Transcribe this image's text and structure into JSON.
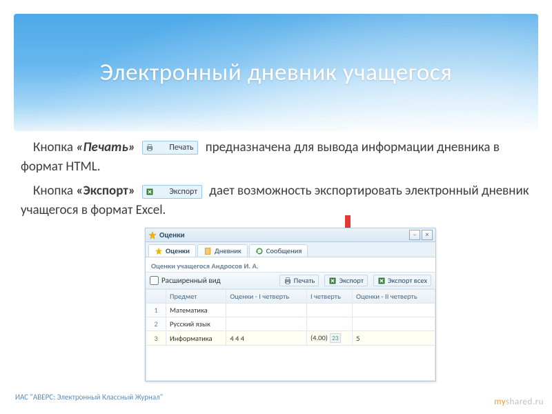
{
  "hero": {
    "title": "Электронный дневник учащегося"
  },
  "body": {
    "p1a": "Кнопка ",
    "p1b": "«Печать»",
    "p1_btn": "Печать",
    "p1c": " предназначена для вывода информации дневника в формат HTML.",
    "p2a": "Кнопка ",
    "p2b": "«Экспорт»",
    "p2_btn": "Экспорт",
    "p2c": " дает возможность экспортировать электронный дневник учащегося в формат Excel."
  },
  "app": {
    "title": "Оценки",
    "win": {
      "min": "–",
      "close": "×"
    },
    "tabs": [
      "Оценки",
      "Дневник",
      "Сообщения"
    ],
    "subhead": "Оценки учащегося Андросов И. А.",
    "toolbar": {
      "extended": "Расширенный вид",
      "print": "Печать",
      "export": "Экспорт",
      "export_all": "Экспорт всех"
    },
    "cols": [
      "",
      "Предмет",
      "Оценки - I четверть",
      "I четверть",
      "Оценки - II четверть"
    ],
    "rows": [
      {
        "n": "1",
        "subject": "Математика",
        "g1": "",
        "q1": "",
        "g2": ""
      },
      {
        "n": "2",
        "subject": "Русский язык",
        "g1": "",
        "q1": "",
        "g2": ""
      },
      {
        "n": "3",
        "subject": "Информатика",
        "g1": "4 4 4",
        "q1": "(4.00)",
        "q1badge": "23",
        "g2": "5"
      }
    ]
  },
  "footer": {
    "left": "ИАС \"АВЕРС: Электронный Классный Журнал\"",
    "right_my": "my",
    "right_rest": "shared.ru"
  }
}
